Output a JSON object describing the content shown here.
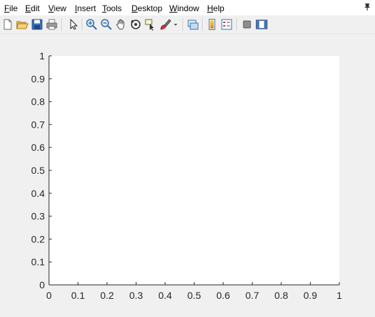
{
  "menu": {
    "items": [
      {
        "label": "File",
        "mnemonic": "F",
        "rest": "ile"
      },
      {
        "label": "Edit",
        "mnemonic": "E",
        "rest": "dit"
      },
      {
        "label": "View",
        "mnemonic": "V",
        "rest": "iew"
      },
      {
        "label": "Insert",
        "mnemonic": "I",
        "rest": "nsert"
      },
      {
        "label": "Tools",
        "mnemonic": "T",
        "rest": "ools"
      },
      {
        "label": "Desktop",
        "mnemonic": "D",
        "rest": "esktop"
      },
      {
        "label": "Window",
        "mnemonic": "W",
        "rest": "indow"
      },
      {
        "label": "Help",
        "mnemonic": "H",
        "rest": "elp"
      }
    ]
  },
  "toolbar": {
    "icons": [
      "new-figure-icon",
      "open-file-icon",
      "save-figure-icon",
      "print-figure-icon",
      "edit-plot-icon",
      "zoom-in-icon",
      "zoom-out-icon",
      "pan-icon",
      "rotate-3d-icon",
      "data-cursor-icon",
      "brush-icon",
      "brush-dropdown-icon",
      "link-plot-icon",
      "colorbar-icon",
      "legend-icon",
      "hide-plot-tools-icon",
      "show-plot-tools-icon"
    ]
  },
  "chart_data": {
    "type": "line",
    "series": [],
    "xlim": [
      0,
      1
    ],
    "ylim": [
      0,
      1
    ],
    "xticks": [
      "0",
      "0.1",
      "0.2",
      "0.3",
      "0.4",
      "0.5",
      "0.6",
      "0.7",
      "0.8",
      "0.9",
      "1"
    ],
    "yticks": [
      "0",
      "0.1",
      "0.2",
      "0.3",
      "0.4",
      "0.5",
      "0.6",
      "0.7",
      "0.8",
      "0.9",
      "1"
    ],
    "xlabel": "",
    "ylabel": "",
    "title": "",
    "grid": false,
    "colors": {
      "axes_background": "#ffffff",
      "axis_color": "#262626",
      "figure_background": "#f0f0f0"
    }
  }
}
